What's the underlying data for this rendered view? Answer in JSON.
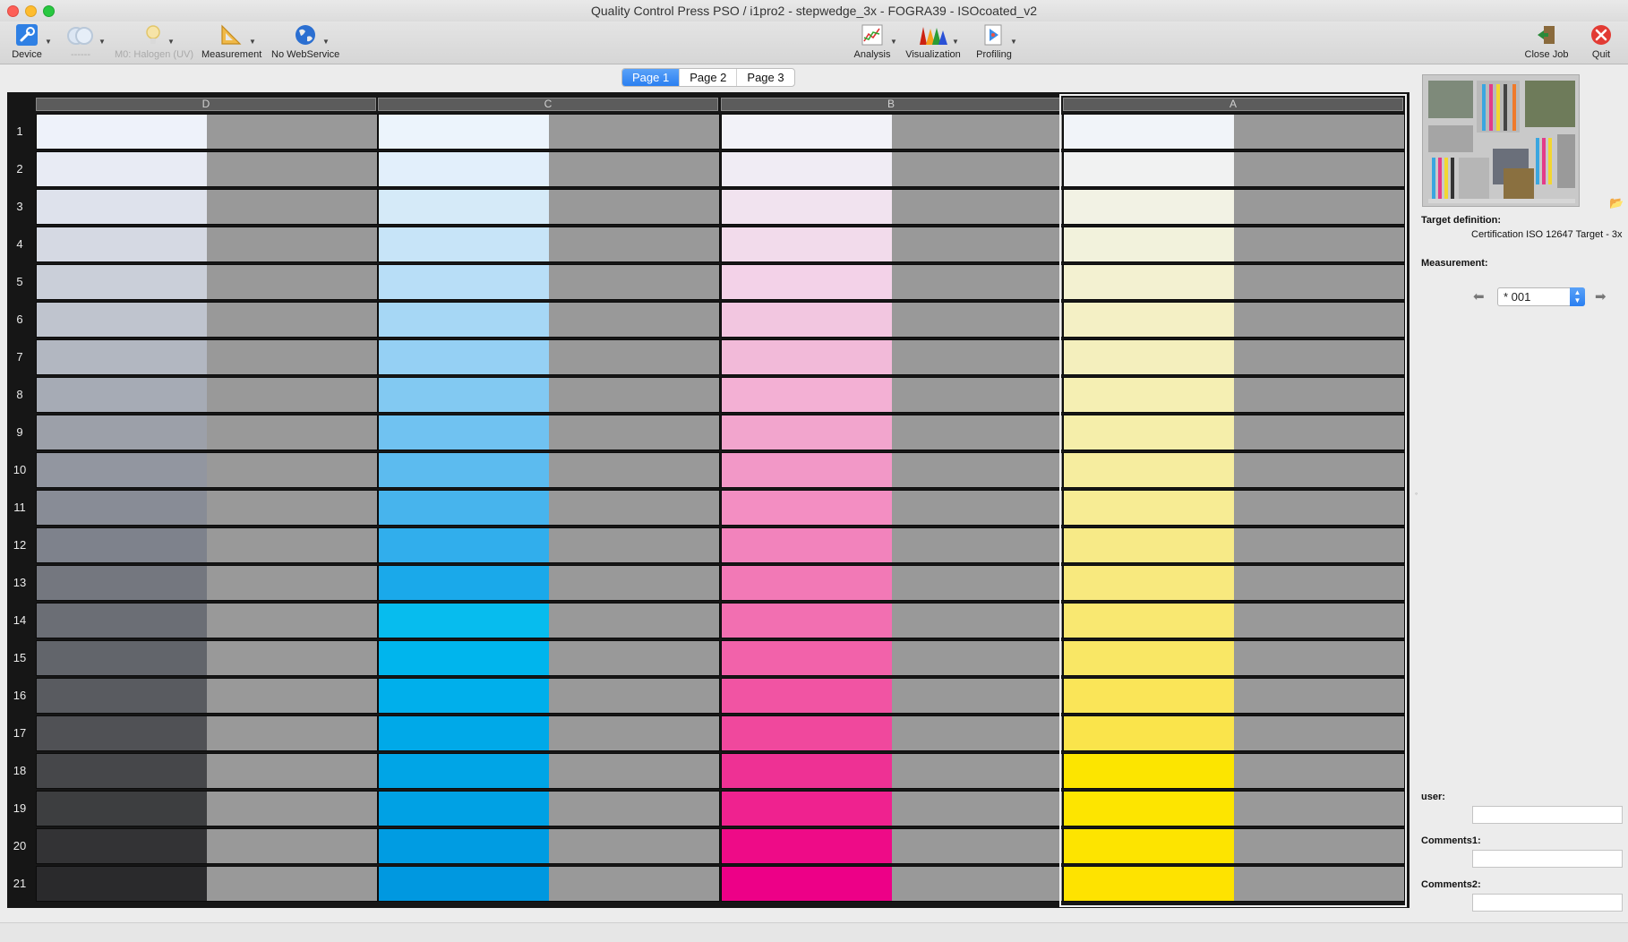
{
  "window": {
    "title": "Quality Control Press PSO / i1pro2 - stepwedge_3x - FOGRA39 - ISOcoated_v2"
  },
  "toolbar": {
    "device": "Device",
    "device_mode": "------",
    "illumination": "M0: Halogen (UV)",
    "measurement": "Measurement",
    "webservice": "No WebService",
    "analysis": "Analysis",
    "visualization": "Visualization",
    "profiling": "Profiling",
    "close_job": "Close Job",
    "quit": "Quit"
  },
  "page_tabs": {
    "items": [
      "Page 1",
      "Page 2",
      "Page 3"
    ],
    "active": 0
  },
  "grid": {
    "columns": [
      {
        "header": "D",
        "colors": [
          "#eef2fa",
          "#e8ebf4",
          "#dee2ec",
          "#d5d9e3",
          "#cacfd9",
          "#bfc4ce",
          "#b2b7c1",
          "#a6abb5",
          "#9ca0a9",
          "#9296a0",
          "#888c96",
          "#7e828c",
          "#74777f",
          "#6b6e75",
          "#62656b",
          "#595b60",
          "#505155",
          "#46474a",
          "#3d3e40",
          "#333335",
          "#2a2a2c"
        ]
      },
      {
        "header": "C",
        "colors": [
          "#ecf4fc",
          "#e2effb",
          "#d5eaf8",
          "#c7e4f8",
          "#b8def7",
          "#a6d7f5",
          "#95d0f4",
          "#82c9f2",
          "#70c2f1",
          "#5cbbef",
          "#47b4ed",
          "#31aeec",
          "#1aa9ea",
          "#07bcee",
          "#00b5ed",
          "#00afeb",
          "#00a9e8",
          "#00a5e6",
          "#00a1e4",
          "#009ce2",
          "#0098e0"
        ]
      },
      {
        "header": "B",
        "colors": [
          "#f2f2f8",
          "#f0ecf4",
          "#f1e3ef",
          "#f2dbeb",
          "#f3d2e8",
          "#f2c6e0",
          "#f2bad9",
          "#f3b0d4",
          "#f2a5cd",
          "#f298c7",
          "#f38ec2",
          "#f283bc",
          "#f279b6",
          "#f26fb1",
          "#f262aa",
          "#f154a3",
          "#f0489d",
          "#ee3194",
          "#ef228f",
          "#ee0b87",
          "#ed0087"
        ]
      },
      {
        "header": "A",
        "colors": [
          "#f1f4f9",
          "#f1f2f2",
          "#f2f2e4",
          "#f2f2dc",
          "#f3f1d1",
          "#f4f0c5",
          "#f4efbd",
          "#f5efb3",
          "#f5eeaa",
          "#f6ed9f",
          "#f7ec94",
          "#f7ea87",
          "#f8e97e",
          "#f9e871",
          "#f9e765",
          "#fae558",
          "#fae44b",
          "#fce500",
          "#fde500",
          "#fde400",
          "#fee300"
        ]
      }
    ],
    "rows": [
      "1",
      "2",
      "3",
      "4",
      "5",
      "6",
      "7",
      "8",
      "9",
      "10",
      "11",
      "12",
      "13",
      "14",
      "15",
      "16",
      "17",
      "18",
      "19",
      "20",
      "21"
    ],
    "selected_column": 3
  },
  "panel": {
    "target_definition_label": "Target definition:",
    "target_definition_value": "Certification ISO 12647 Target - 3x",
    "measurement_label": "Measurement:",
    "measurement_value": "* 001",
    "user_label": "user:",
    "comments1_label": "Comments1:",
    "comments2_label": "Comments2:"
  },
  "colors": {
    "patch_gray": "#999999",
    "accent": "#2a7ff1",
    "grid_bg": "#161616"
  }
}
